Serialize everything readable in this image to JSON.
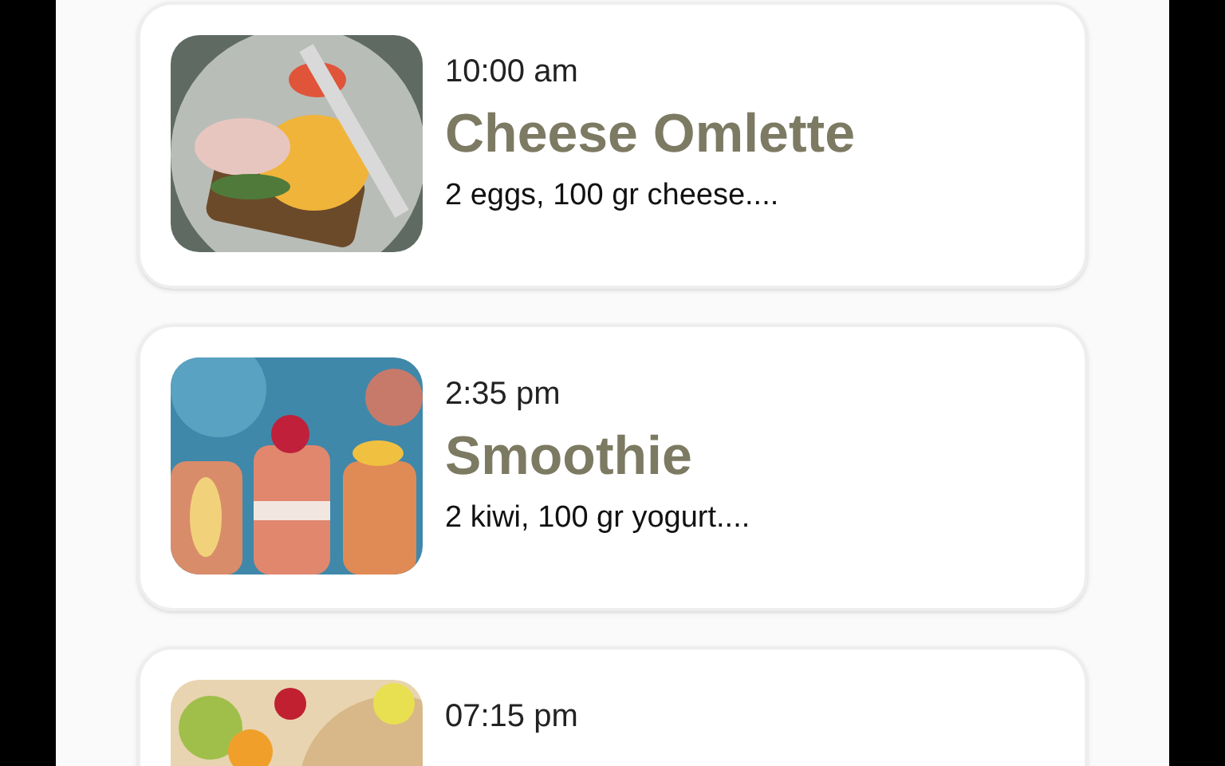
{
  "meals": [
    {
      "time": "10:00 am",
      "name": "Cheese Omlette",
      "ingredients": "2 eggs, 100 gr cheese...."
    },
    {
      "time": "2:35 pm",
      "name": "Smoothie",
      "ingredients": "2 kiwi, 100 gr yogurt...."
    },
    {
      "time": "07:15 pm"
    }
  ]
}
